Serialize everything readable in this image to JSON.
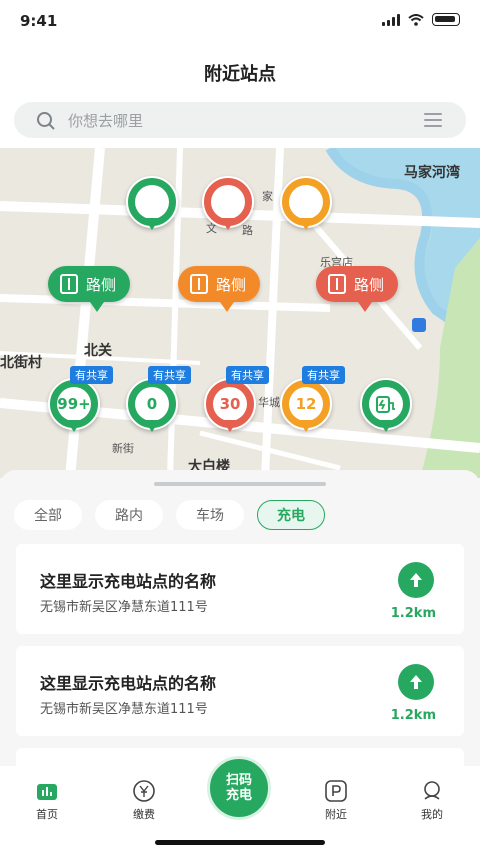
{
  "status": {
    "time": "9:41"
  },
  "header": {
    "title": "附近站点",
    "search_placeholder": "你想去哪里"
  },
  "map": {
    "labels": [
      "马家河湾",
      "北关",
      "北街村",
      "大白楼",
      "华城",
      "新街",
      "家",
      "文",
      "路",
      "乐宫店"
    ],
    "road_pills": [
      {
        "label": "路侧",
        "color": "green"
      },
      {
        "label": "路侧",
        "color": "orange"
      },
      {
        "label": "路侧",
        "color": "red"
      }
    ],
    "pins_top": [
      "",
      "",
      ""
    ],
    "pins_shared": [
      {
        "badge": "有共享",
        "count": "99+",
        "color": "green"
      },
      {
        "badge": "有共享",
        "count": "0",
        "color": "green"
      },
      {
        "badge": "有共享",
        "count": "30",
        "color": "red"
      },
      {
        "badge": "有共享",
        "count": "12",
        "color": "orange"
      }
    ]
  },
  "filters": [
    "全部",
    "路内",
    "车场",
    "充电"
  ],
  "active_filter": "充电",
  "stations": [
    {
      "name": "这里显示充电站点的名称",
      "address": "无锡市新吴区净慧东道111号",
      "distance": "1.2km"
    },
    {
      "name": "这里显示充电站点的名称",
      "address": "无锡市新吴区净慧东道111号",
      "distance": "1.2km"
    }
  ],
  "tabbar": {
    "home": "首页",
    "pay": "缴费",
    "scan_line1": "扫码",
    "scan_line2": "充电",
    "nearby": "附近",
    "mine": "我的"
  },
  "colors": {
    "primary": "#27a860",
    "orange": "#f3a024",
    "red": "#e5604e",
    "badge": "#1f7de0"
  }
}
